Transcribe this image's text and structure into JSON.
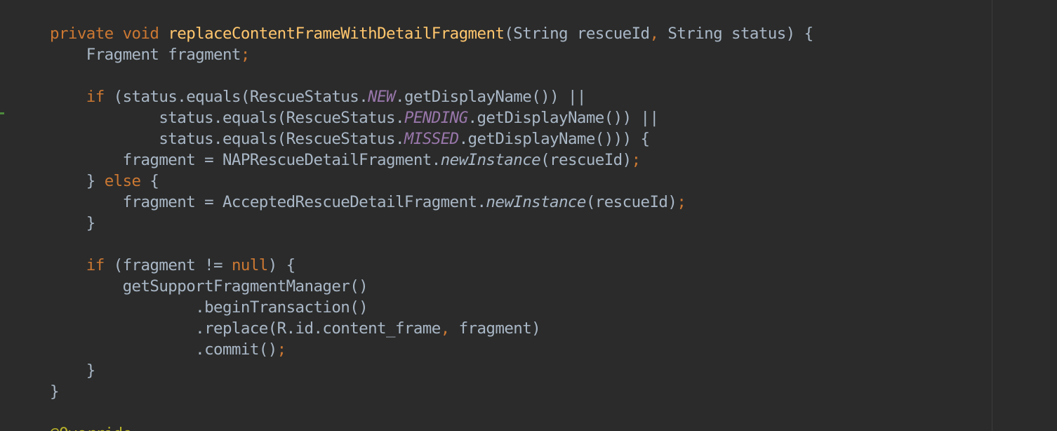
{
  "editor": {
    "theme": "darcula",
    "colors": {
      "background": "#2b2b2b",
      "default_text": "#a9b7c6",
      "keyword": "#cc7832",
      "method_declaration": "#ffc66d",
      "static_field": "#9876aa",
      "annotation": "#bbb529",
      "change_marker": "#4c8a3b"
    },
    "lines": [
      [
        {
          "t": "private",
          "k": "kw"
        },
        {
          "t": " "
        },
        {
          "t": "void",
          "k": "kw"
        },
        {
          "t": " "
        },
        {
          "t": "replaceContentFrameWithDetailFragment",
          "k": "fn"
        },
        {
          "t": "(String rescueId"
        },
        {
          "t": ",",
          "k": "punc"
        },
        {
          "t": " String status) {"
        }
      ],
      [
        {
          "t": "    Fragment fragment"
        },
        {
          "t": ";",
          "k": "punc"
        }
      ],
      [],
      [
        {
          "t": "    "
        },
        {
          "t": "if",
          "k": "kw"
        },
        {
          "t": " (status.equals(RescueStatus."
        },
        {
          "t": "NEW",
          "k": "field"
        },
        {
          "t": ".getDisplayName()) ||"
        }
      ],
      [
        {
          "t": "            status.equals(RescueStatus."
        },
        {
          "t": "PENDING",
          "k": "field"
        },
        {
          "t": ".getDisplayName()) ||"
        }
      ],
      [
        {
          "t": "            status.equals(RescueStatus."
        },
        {
          "t": "MISSED",
          "k": "field"
        },
        {
          "t": ".getDisplayName())) {"
        }
      ],
      [
        {
          "t": "        fragment = NAPRescueDetailFragment."
        },
        {
          "t": "newInstance",
          "k": "static-call"
        },
        {
          "t": "(rescueId)"
        },
        {
          "t": ";",
          "k": "punc"
        }
      ],
      [
        {
          "t": "    } "
        },
        {
          "t": "else",
          "k": "kw"
        },
        {
          "t": " {"
        }
      ],
      [
        {
          "t": "        fragment = AcceptedRescueDetailFragment."
        },
        {
          "t": "newInstance",
          "k": "static-call"
        },
        {
          "t": "(rescueId)"
        },
        {
          "t": ";",
          "k": "punc"
        }
      ],
      [
        {
          "t": "    }"
        }
      ],
      [],
      [
        {
          "t": "    "
        },
        {
          "t": "if",
          "k": "kw"
        },
        {
          "t": " (fragment != "
        },
        {
          "t": "null",
          "k": "kw"
        },
        {
          "t": ") {"
        }
      ],
      [
        {
          "t": "        getSupportFragmentManager()"
        }
      ],
      [
        {
          "t": "                .beginTransaction()"
        }
      ],
      [
        {
          "t": "                .replace(R.id.content_frame"
        },
        {
          "t": ",",
          "k": "punc"
        },
        {
          "t": " fragment)"
        }
      ],
      [
        {
          "t": "                .commit()"
        },
        {
          "t": ";",
          "k": "punc"
        }
      ],
      [
        {
          "t": "    }"
        }
      ],
      [
        {
          "t": "}"
        }
      ],
      [],
      [
        {
          "t": "@Override",
          "k": "anno"
        }
      ]
    ]
  }
}
